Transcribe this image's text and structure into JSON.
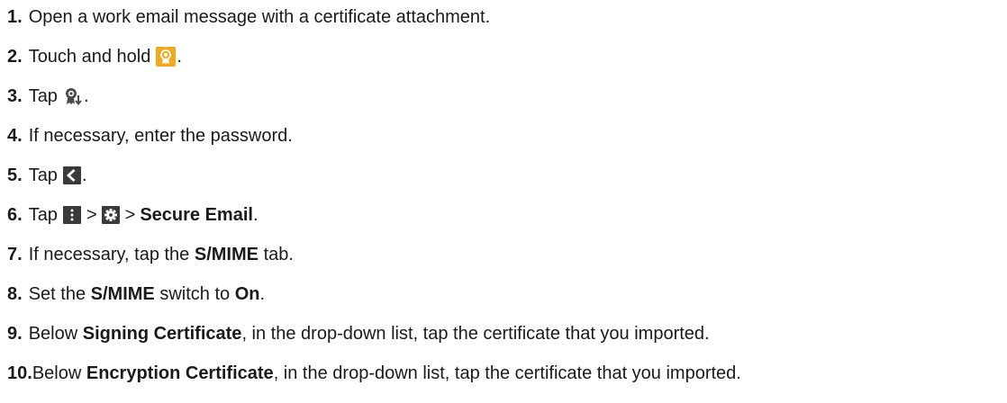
{
  "steps": [
    {
      "num": "1.",
      "text": "Open a work email message with a certificate attachment."
    },
    {
      "num": "2.",
      "pre": "Touch and hold",
      "post": "."
    },
    {
      "num": "3.",
      "pre": "Tap",
      "post": "."
    },
    {
      "num": "4.",
      "text": "If necessary, enter the password."
    },
    {
      "num": "5.",
      "pre": "Tap",
      "post": "."
    },
    {
      "num": "6.",
      "pre": "Tap",
      "sep1": ">",
      "sep2": ">",
      "bold": "Secure Email",
      "post": "."
    },
    {
      "num": "7.",
      "pre": "If necessary, tap the",
      "bold": "S/MIME",
      "post": "tab."
    },
    {
      "num": "8.",
      "pre": "Set the",
      "bold": "S/MIME",
      "mid": "switch to",
      "bold2": "On",
      "post": "."
    },
    {
      "num": "9.",
      "pre": "Below",
      "bold": "Signing Certificate",
      "post": ", in the drop-down list, tap the certificate that you imported."
    },
    {
      "num": "10.",
      "pre": "Below",
      "bold": "Encryption Certificate",
      "post": ", in the drop-down list, tap the certificate that you imported."
    }
  ],
  "icons": {
    "certificate": "certificate-icon",
    "import_certificate": "import-certificate-icon",
    "back": "back-arrow-icon",
    "menu": "more-menu-icon",
    "settings": "settings-gear-icon"
  },
  "colors": {
    "certificate_bg": "#f2a81d",
    "icon_dark": "#3a3a3a"
  }
}
